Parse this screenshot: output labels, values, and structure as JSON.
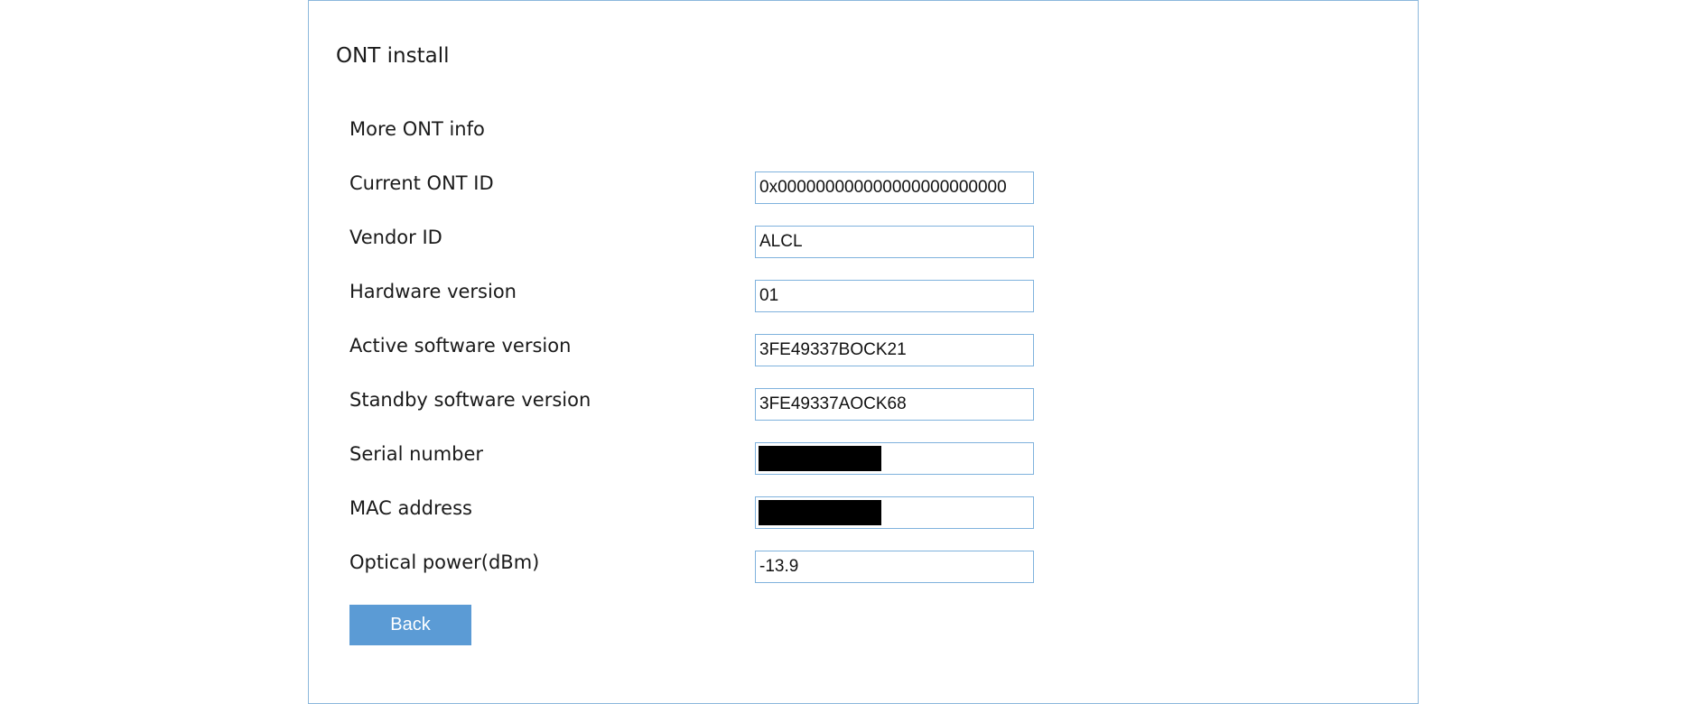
{
  "page": {
    "title": "ONT install"
  },
  "section": {
    "title": "More ONT info"
  },
  "fields": [
    {
      "label": "Current ONT ID",
      "value": "0x000000000000000000000000"
    },
    {
      "label": "Vendor ID",
      "value": "ALCL"
    },
    {
      "label": "Hardware version",
      "value": "01"
    },
    {
      "label": "Active software version",
      "value": "3FE49337BOCK21"
    },
    {
      "label": "Standby software version",
      "value": "3FE49337AOCK68"
    },
    {
      "label": "Serial number",
      "value": "",
      "redacted": true
    },
    {
      "label": "MAC address",
      "value": "",
      "redacted": true
    },
    {
      "label": "Optical power(dBm)",
      "value": "-13.9"
    }
  ],
  "actions": {
    "back_label": "Back"
  },
  "colors": {
    "panel_border": "#8cb8dc",
    "field_border": "#7fb2dd",
    "button_bg": "#5b9bd5",
    "redaction": "#000000"
  }
}
